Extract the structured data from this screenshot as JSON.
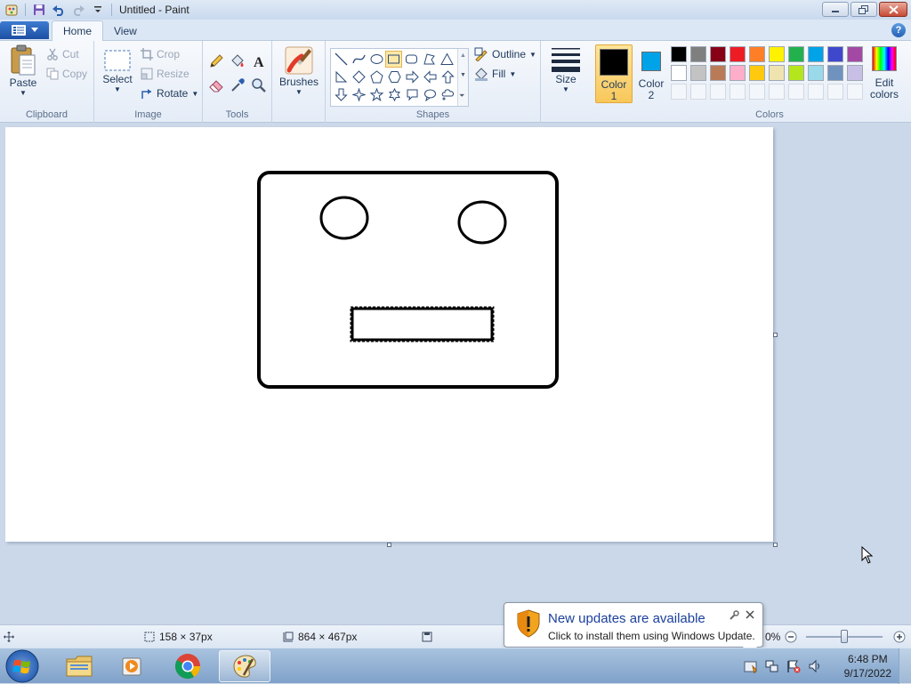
{
  "window": {
    "title": "Untitled - Paint"
  },
  "tabs": [
    {
      "label": "Home"
    },
    {
      "label": "View"
    }
  ],
  "groups": {
    "clipboard": {
      "label": "Clipboard",
      "paste": "Paste",
      "cut": "Cut",
      "copy": "Copy"
    },
    "image": {
      "label": "Image",
      "select": "Select",
      "crop": "Crop",
      "resize": "Resize",
      "rotate": "Rotate"
    },
    "tools": {
      "label": "Tools",
      "items": [
        "pencil-icon",
        "fill-icon",
        "text-icon",
        "eraser-icon",
        "color-picker-icon",
        "magnifier-icon"
      ]
    },
    "brushes": {
      "label": "Brushes"
    },
    "shapes": {
      "label": "Shapes",
      "outline": "Outline",
      "fill": "Fill"
    },
    "size": {
      "label": "Size"
    },
    "color1": {
      "line1": "Color",
      "line2": "1",
      "color": "#000000"
    },
    "color2": {
      "line1": "Color",
      "line2": "2",
      "color": "#00a2e8"
    },
    "colors": {
      "label": "Colors",
      "row1": [
        "#000000",
        "#7f7f7f",
        "#880015",
        "#ed1c24",
        "#ff7f27",
        "#fff200",
        "#22b14c",
        "#00a2e8",
        "#3f48cc",
        "#a349a4"
      ],
      "row2": [
        "#ffffff",
        "#c3c3c3",
        "#b97a57",
        "#ffaec9",
        "#ffc90e",
        "#efe4b0",
        "#b5e61d",
        "#99d9ea",
        "#7092be",
        "#c8bfe7"
      ]
    },
    "edit_colors": {
      "line1": "Edit",
      "line2": "colors"
    }
  },
  "status": {
    "selection_size": "158 × 37px",
    "canvas_size": "864 × 467px",
    "zoom_partial": "0%"
  },
  "notification": {
    "title": "New updates are available",
    "body": "Click to install them using Windows Update."
  },
  "taskbar": {
    "time": "6:48 PM",
    "date": "9/17/2022"
  }
}
